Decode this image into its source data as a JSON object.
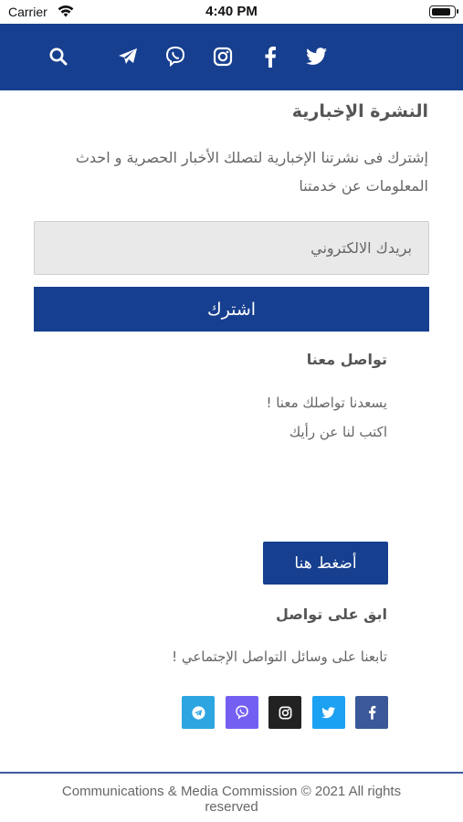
{
  "status_bar": {
    "carrier": "Carrier",
    "time": "4:40 PM"
  },
  "header": {
    "icons": [
      "search-icon",
      "telegram-icon",
      "viber-icon",
      "instagram-icon",
      "facebook-icon",
      "twitter-icon"
    ]
  },
  "newsletter": {
    "title": "النشرة الإخبارية",
    "description": "إشترك فى نشرتنا الإخبارية لتصلك الأخبار الحصرية و احدث المعلومات عن خدمتنا",
    "email_placeholder": "بريدك الالكتروني",
    "subscribe_label": "اشترك"
  },
  "contact": {
    "title": "تواصل معنا",
    "line1": "يسعدنا تواصلك معنا !",
    "line2": "اكتب لنا عن رأيك",
    "button_label": "أضغط هنا"
  },
  "stay_connected": {
    "title": "ابق على تواصل",
    "description": "تابعنا على وسائل التواصل الإجتماعي !",
    "social": [
      {
        "name": "facebook-icon",
        "color": "#3b5998"
      },
      {
        "name": "twitter-icon",
        "color": "#1da1f2"
      },
      {
        "name": "instagram-icon",
        "color": "#222222"
      },
      {
        "name": "viber-icon",
        "color": "#7360f2"
      },
      {
        "name": "telegram-icon",
        "color": "#2ca5e0"
      }
    ]
  },
  "footer": {
    "text": "Communications & Media Commission © 2021 All rights reserved"
  },
  "colors": {
    "primary": "#173f8f",
    "input_bg": "#e9e9e9"
  }
}
